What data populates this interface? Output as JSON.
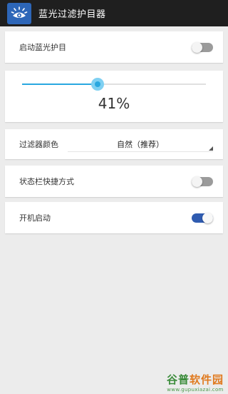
{
  "app": {
    "title": "蓝光过滤护目器",
    "icon": "eye-sun-icon",
    "accent": "#2d66b8"
  },
  "settings": {
    "enable_label": "启动蓝光护目",
    "enable_on": false,
    "intensity_percent": 41,
    "intensity_text": "41%",
    "filter_color_label": "过滤器颜色",
    "filter_color_value": "自然（推荐）",
    "statusbar_label": "状态栏快捷方式",
    "statusbar_on": false,
    "boot_label": "开机启动",
    "boot_on": true
  },
  "colors": {
    "slider": "#29a8e0",
    "toggle_on": "#2f5bb0",
    "toggle_off": "#9b9b9b"
  },
  "watermark": {
    "logo_part1": "谷普",
    "logo_part2": "软件园",
    "url": "www.gupuxiazai.com"
  }
}
